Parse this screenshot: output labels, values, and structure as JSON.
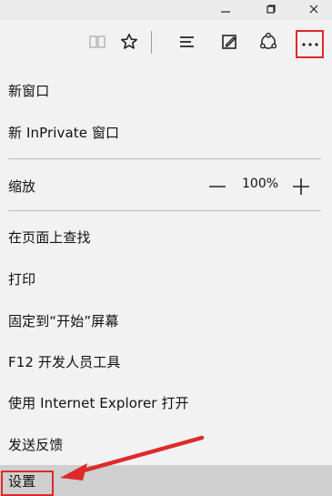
{
  "window_controls": {
    "minimize_icon": "minimize-icon",
    "restore_icon": "restore-icon",
    "close_icon": "close-icon"
  },
  "toolbar": {
    "reading_view_icon": "reading-view-icon",
    "favorite_icon": "favorite-icon",
    "hub_icon": "hub-icon",
    "note_icon": "web-note-icon",
    "share_icon": "share-icon",
    "more_icon": "more-icon"
  },
  "menu": {
    "new_window": "新窗口",
    "new_inprivate_window": "新 InPrivate 窗口",
    "zoom_label": "缩放",
    "zoom_value": "100%",
    "find_on_page": "在页面上查找",
    "print": "打印",
    "pin_to_start": "固定到“开始”屏幕",
    "f12_dev_tools": "F12 开发人员工具",
    "open_with_ie": "使用 Internet Explorer 打开",
    "send_feedback": "发送反馈",
    "settings": "设置"
  },
  "colors": {
    "annotation_red": "#df2a2a",
    "panel_bg": "#f2f2f2",
    "selected_bg": "#cfcfcf"
  }
}
